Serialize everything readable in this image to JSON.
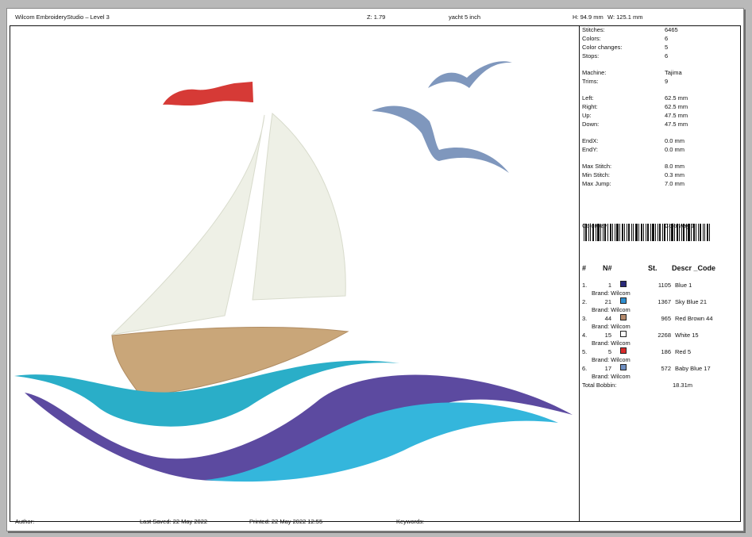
{
  "header": {
    "title": "Wilcom EmbroideryStudio – Level 3",
    "zoom": "Z: 1.79",
    "design_name": "yacht 5 inch",
    "height": "H: 94.9 mm",
    "width": "W: 125.1 mm"
  },
  "stats": [
    {
      "label": "Stitches:",
      "value": "6465"
    },
    {
      "label": "Colors:",
      "value": "6"
    },
    {
      "label": "Color changes:",
      "value": "5"
    },
    {
      "label": "Stops:",
      "value": "6"
    },
    {
      "label": "Machine:",
      "value": "Tajima"
    },
    {
      "label": "Trims:",
      "value": "9"
    },
    {
      "label": "Left:",
      "value": "62.5 mm"
    },
    {
      "label": "Right:",
      "value": "62.5 mm"
    },
    {
      "label": "Up:",
      "value": "47.5 mm"
    },
    {
      "label": "Down:",
      "value": "47.5 mm"
    },
    {
      "label": "EndX:",
      "value": "0.0 mm"
    },
    {
      "label": "EndY:",
      "value": "0.0 mm"
    },
    {
      "label": "Max Stitch:",
      "value": "8.0 mm"
    },
    {
      "label": "Min Stitch:",
      "value": "0.3 mm"
    },
    {
      "label": "Max Jump:",
      "value": "7.0 mm"
    }
  ],
  "colorway": {
    "label": "Colorway:",
    "value": "Colorway 1"
  },
  "table_headers": {
    "hash": "#",
    "num": "N#",
    "st": "St.",
    "desc": "Descr _Code"
  },
  "colors": [
    {
      "index": "1.",
      "num": "1",
      "swatch": "#2a2a7a",
      "stitches": "1105",
      "desc": "Blue 1",
      "brand": "Brand: Wilcom"
    },
    {
      "index": "2.",
      "num": "21",
      "swatch": "#2f8fd0",
      "stitches": "1367",
      "desc": "Sky Blue 21",
      "brand": "Brand: Wilcom"
    },
    {
      "index": "3.",
      "num": "44",
      "swatch": "#b58a6c",
      "stitches": "965",
      "desc": "Red Brown 44",
      "brand": "Brand: Wilcom"
    },
    {
      "index": "4.",
      "num": "15",
      "swatch": "#ffffff",
      "stitches": "2268",
      "desc": "White 15",
      "brand": "Brand: Wilcom"
    },
    {
      "index": "5.",
      "num": "5",
      "swatch": "#d92b2b",
      "stitches": "186",
      "desc": "Red 5",
      "brand": "Brand: Wilcom"
    },
    {
      "index": "6.",
      "num": "17",
      "swatch": "#6f8fc2",
      "stitches": "572",
      "desc": "Baby Blue 17",
      "brand": "Brand: Wilcom"
    }
  ],
  "total_bobbin": {
    "label": "Total Bobbin:",
    "value": "18.31m"
  },
  "footer": {
    "author": "Author:",
    "last_saved": "Last Saved: 22 May 2022",
    "printed": "Printed: 22 May 2022 12:55",
    "keywords": "Keywords:"
  },
  "design_colors": {
    "flag": "#d63a36",
    "sail": "#eef0e6",
    "hull": "#c9a679",
    "wave_teal": "#2aaec8",
    "wave_purple": "#5c4aa0",
    "wave_cyan": "#34b6dc",
    "gull": "#7f97bd"
  }
}
